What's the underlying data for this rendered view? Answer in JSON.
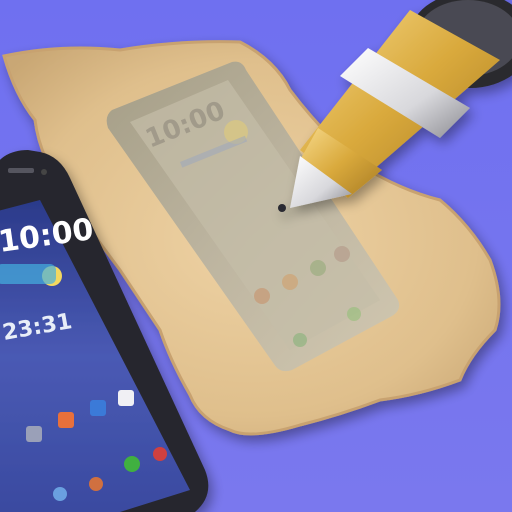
{
  "colors": {
    "background": "#7272ee",
    "parchment": "#e2c393",
    "pen_gold": "#e0b040",
    "phone_body": "#2a2a34",
    "phone_screen": "#3a4a9c"
  },
  "phone": {
    "time": "10:00",
    "date": "23:31"
  },
  "app_icon": {
    "depicts": "smartphone-and-ballpoint-pen-tracing-phone-on-parchment"
  }
}
